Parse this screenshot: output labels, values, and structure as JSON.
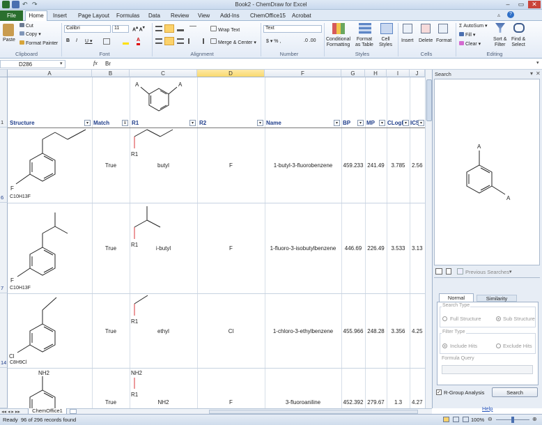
{
  "window": {
    "title": "Book2 - ChemDraw for Excel"
  },
  "tabs": [
    "File",
    "Home",
    "Insert",
    "Page Layout",
    "Formulas",
    "Data",
    "Review",
    "View",
    "Add-Ins",
    "ChemOffice15",
    "Acrobat"
  ],
  "ribbon": {
    "clipboard": {
      "paste": "Paste",
      "cut": "Cut",
      "copy": "Copy",
      "format_painter": "Format Painter",
      "label": "Clipboard"
    },
    "font": {
      "name": "Calibri",
      "size": "11",
      "label": "Font"
    },
    "alignment": {
      "wrap_text": "Wrap Text",
      "merge_center": "Merge & Center",
      "label": "Alignment"
    },
    "number": {
      "format": "Text",
      "label": "Number"
    },
    "styles": {
      "conditional": "Conditional\nFormatting",
      "format_table": "Format\nas Table",
      "cell_styles": "Cell\nStyles",
      "label": "Styles"
    },
    "cells": {
      "insert": "Insert",
      "delete": "Delete",
      "format": "Format",
      "label": "Cells"
    },
    "editing": {
      "autosum": "AutoSum",
      "fill": "Fill",
      "clear": "Clear",
      "sort_filter": "Sort &\nFilter",
      "find_select": "Find &\nSelect",
      "label": "Editing"
    }
  },
  "formula_bar": {
    "name_box": "D286",
    "fx": "fx",
    "value": "Br"
  },
  "columns": [
    "A",
    "B",
    "C",
    "D",
    "E",
    "F",
    "G",
    "H",
    "I",
    "J"
  ],
  "headers": {
    "structure": "Structure",
    "match": "Match",
    "r1": "R1",
    "r2": "R2",
    "name": "Name",
    "bp": "BP",
    "mp": "MP",
    "clogp": "CLogP",
    "ic": "IC5"
  },
  "rows": [
    {
      "row": "6",
      "formula": "C10H13F",
      "match": "True",
      "r1": "butyl",
      "r2": "F",
      "name": "1-butyl-3-fluorobenzene",
      "bp": "459.233",
      "mp": "241.49",
      "clogp": "3.785",
      "ic": "2.56"
    },
    {
      "row": "7",
      "formula": "C10H13F",
      "match": "True",
      "r1": "i-butyl",
      "r2": "F",
      "name": "1-fluoro-3-isobutylbenzene",
      "bp": "446.69",
      "mp": "226.49",
      "clogp": "3.533",
      "ic": "3.13"
    },
    {
      "row": "14",
      "formula": "C8H9Cl",
      "match": "True",
      "r1": "ethyl",
      "r2": "Cl",
      "name": "1-chloro-3-ethylbenzene",
      "bp": "455.966",
      "mp": "248.28",
      "clogp": "3.356",
      "ic": "4.25"
    },
    {
      "row": "",
      "formula": "",
      "match": "True",
      "r1": "NH2",
      "r2": "F",
      "name": "3-fluoroaniline",
      "bp": "452.392",
      "mp": "279.67",
      "clogp": "1.3",
      "ic": "4.27"
    }
  ],
  "atom_labels": {
    "a": "A",
    "f": "F",
    "cl": "Cl",
    "nh2": "NH2",
    "r1": "R1"
  },
  "search_panel": {
    "title": "Search",
    "previous": "Previous Searches",
    "tabs": [
      "Normal",
      "Similarity"
    ],
    "search_type": "Search Type",
    "full_structure": "Full Structure",
    "sub_structure": "Sub Structure",
    "filter_type": "Filter Type",
    "include_hits": "Include Hits",
    "exclude_hits": "Exclude Hits",
    "formula_query": "Formula Query",
    "rgroup": "R-Group Analysis",
    "search_btn": "Search",
    "help": "Help"
  },
  "sheet_tab": "ChemOffice1",
  "status": {
    "ready": "Ready",
    "records": "96 of 296 records found",
    "zoom": "100%"
  }
}
